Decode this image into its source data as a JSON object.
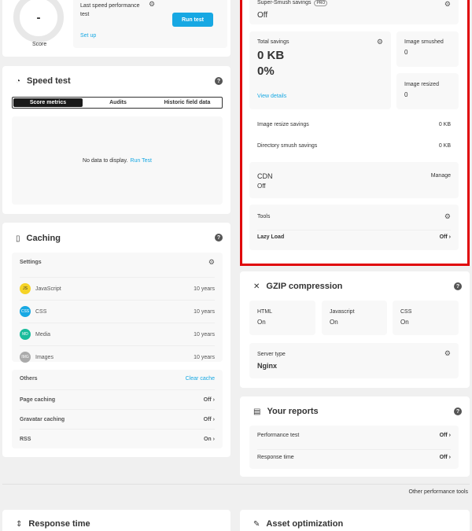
{
  "score_widget": {
    "value": "-",
    "label": "Score"
  },
  "last_test": {
    "label": "Last speed performance test",
    "setup": "Set up",
    "run": "Run test"
  },
  "speed_test": {
    "title": "Speed test",
    "tabs": [
      "Score metrics",
      "Audits",
      "Historic field data"
    ],
    "empty": "No data to display.",
    "empty_link": "Run Test"
  },
  "caching": {
    "title": "Caching",
    "settings_label": "Settings",
    "items": [
      {
        "icon": "JS",
        "name": "JavaScript",
        "value": "10 years",
        "color": "#f5d327"
      },
      {
        "icon": "CSS",
        "name": "CSS",
        "value": "10 years",
        "color": "#17a8e3"
      },
      {
        "icon": "MD",
        "name": "Media",
        "value": "10 years",
        "color": "#1abc9c"
      },
      {
        "icon": "IMG",
        "name": "Images",
        "value": "10 years",
        "color": "#aaaaaa"
      }
    ],
    "others_label": "Others",
    "clear": "Clear cache",
    "other_items": [
      {
        "name": "Page caching",
        "value": "Off"
      },
      {
        "name": "Gravatar caching",
        "value": "Off"
      },
      {
        "name": "RSS",
        "value": "On"
      }
    ]
  },
  "response_time": {
    "title": "Response time"
  },
  "smush": {
    "super_label": "Super-Smush savings",
    "pro": "PRO",
    "super_value": "Off",
    "total_label": "Total savings",
    "total_kb": "0 KB",
    "total_pct": "0%",
    "view": "View details",
    "smushed_label": "Image smushed",
    "smushed_value": "0",
    "resized_label": "Image resized",
    "resized_value": "0",
    "resize_savings_label": "Image resize savings",
    "resize_savings_value": "0 KB",
    "dir_label": "Directory smush savings",
    "dir_value": "0 KB",
    "cdn_label": "CDN",
    "cdn_value": "Off",
    "cdn_manage": "Manage",
    "tools_label": "Tools",
    "lazy_label": "Lazy Load",
    "lazy_value": "Off"
  },
  "gzip": {
    "title": "GZIP compression",
    "items": [
      {
        "label": "HTML",
        "value": "On"
      },
      {
        "label": "Javascript",
        "value": "On"
      },
      {
        "label": "CSS",
        "value": "On"
      }
    ],
    "server_label": "Server type",
    "server_value": "Nginx"
  },
  "reports": {
    "title": "Your reports",
    "items": [
      {
        "name": "Performance test",
        "value": "Off"
      },
      {
        "name": "Response time",
        "value": "Off"
      }
    ]
  },
  "other_tools": "Other performance tools",
  "asset": {
    "title": "Asset optimization"
  },
  "colors": {
    "highlight": "#e0060a",
    "accent": "#17a8e3",
    "dark": "#1a1a1a"
  }
}
